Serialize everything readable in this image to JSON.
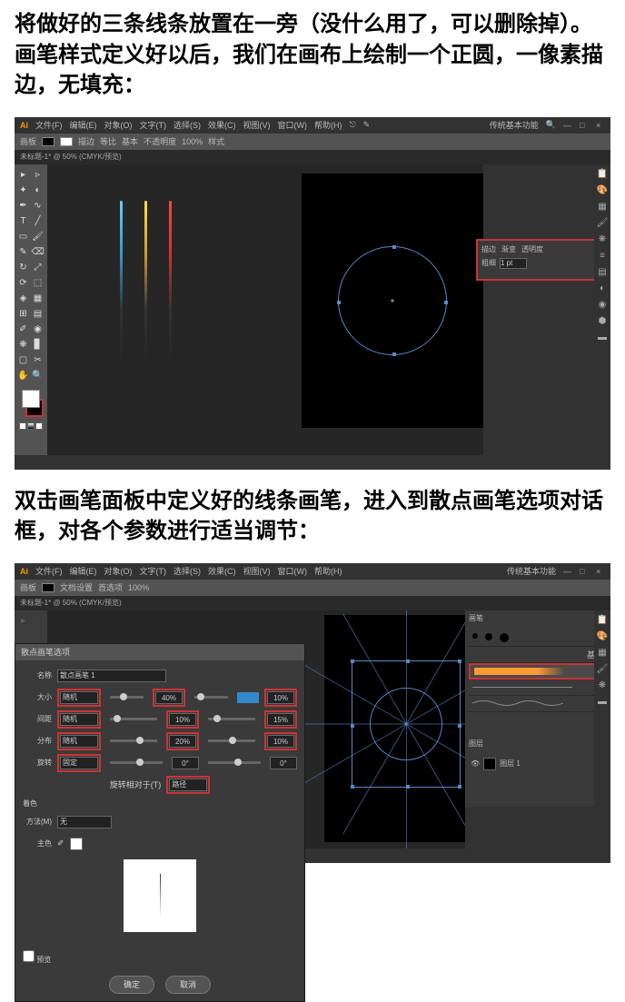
{
  "paragraphs": {
    "p1": "将做好的三条线条放置在一旁（没什么用了，可以删除掉）。",
    "p2": "画笔样式定义好以后，我们在画布上绘制一个正圆，一像素描边，无填充：",
    "p3": "双击画笔面板中定义好的线条画笔，进入到散点画笔选项对话框，对各个参数进行适当调节："
  },
  "app": {
    "logo": "Ai",
    "menus": [
      "文件(F)",
      "编辑(E)",
      "对象(O)",
      "文字(T)",
      "选择(S)",
      "效果(C)",
      "视图(V)",
      "窗口(W)",
      "帮助(H)"
    ],
    "workspace_label": "传统基本功能",
    "win_min": "—",
    "win_max": "□",
    "win_close": "×"
  },
  "toolbar": {
    "no_sel": "画板",
    "stroke_label": "描边",
    "opacity_label": "不透明度",
    "opacity_val": "100%",
    "style_label": "样式",
    "doc_setup": "文档设置",
    "prefs": "首选项",
    "basic": "基本",
    "uniform": "等比"
  },
  "tab": {
    "tab1": "未标题-1* @ 50% (CMYK/预览)"
  },
  "stroke_panel": {
    "tab1": "描边",
    "tab2": "渐变",
    "tab3": "透明度",
    "weight_label": "粗细",
    "weight_val": "1 pt"
  },
  "dialog": {
    "title": "散点画笔选项",
    "name_label": "名称",
    "name_val": "散点画笔 1",
    "size_label": "大小",
    "size_mode": "随机",
    "size_v1": "40%",
    "size_v2": "10%",
    "spacing_label": "间距",
    "spacing_mode": "随机",
    "spacing_v1": "10%",
    "spacing_v2": "15%",
    "scatter_label": "分布",
    "scatter_mode": "随机",
    "scatter_v1": "20%",
    "scatter_v2": "10%",
    "rotation_label": "旋转",
    "rotation_mode": "固定",
    "rotation_v1": "0°",
    "rotation_v2": "0°",
    "rot_rel_label": "旋转相对于(T)",
    "rot_rel_val": "路径",
    "colorization": "着色",
    "method_label": "方法(M)",
    "method_val": "无",
    "keycolor_label": "主色",
    "preview": "预览",
    "ok": "确定",
    "cancel": "取消"
  },
  "panels": {
    "brushes": "画笔",
    "basic": "基本",
    "layers": "图层",
    "layer1": "图层 1"
  }
}
